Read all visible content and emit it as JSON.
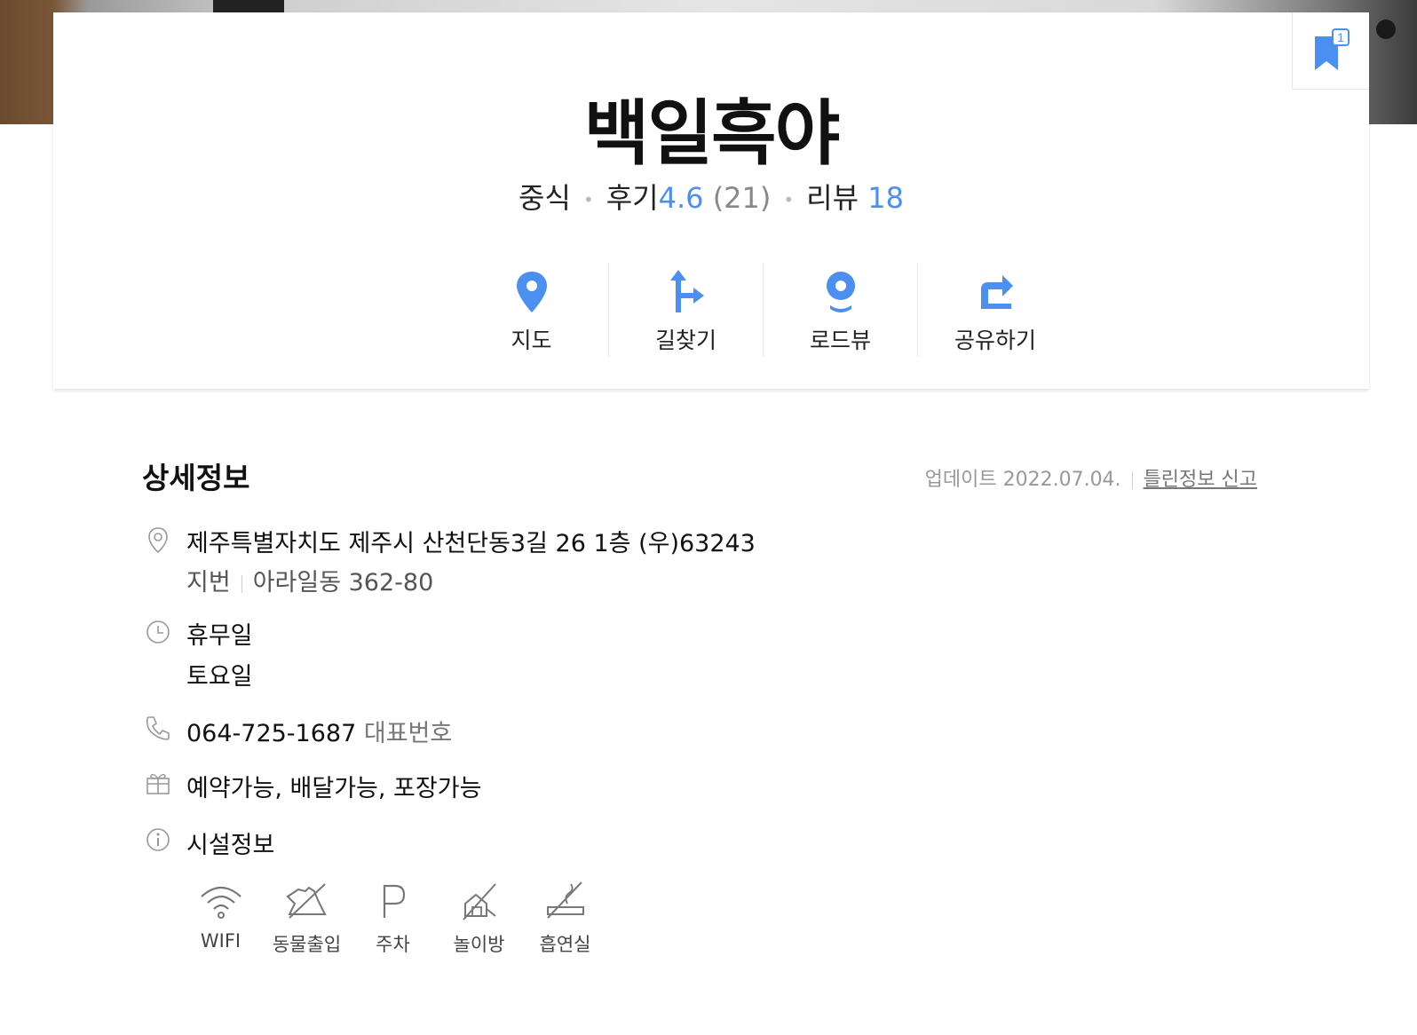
{
  "header": {
    "bookmark_count": "1",
    "place_name": "백일흑야",
    "category": "중식",
    "review_label": "후기",
    "rating": "4.6",
    "rating_count": "(21)",
    "review2_label": "리뷰",
    "review2_count": "18"
  },
  "actions": [
    {
      "label": "지도",
      "icon": "map-pin-icon"
    },
    {
      "label": "길찾기",
      "icon": "directions-icon"
    },
    {
      "label": "로드뷰",
      "icon": "roadview-icon"
    },
    {
      "label": "공유하기",
      "icon": "share-icon"
    }
  ],
  "detail": {
    "title": "상세정보",
    "updated": "업데이트 2022.07.04.",
    "report_label": "틀린정보 신고",
    "address": "제주특별자치도 제주시 산천단동3길 26 1층 (우)63243",
    "lot_label": "지번",
    "lot_address": "아라일동 362-80",
    "holiday_label": "휴무일",
    "holiday_value": "토요일",
    "phone": "064-725-1687",
    "phone_label": "대표번호",
    "services": "예약가능, 배달가능, 포장가능",
    "facility_title": "시설정보",
    "facilities": [
      {
        "label": "WIFI",
        "icon": "wifi-icon"
      },
      {
        "label": "동물출입",
        "icon": "no-pets-icon"
      },
      {
        "label": "주차",
        "icon": "parking-icon"
      },
      {
        "label": "놀이방",
        "icon": "no-playroom-icon"
      },
      {
        "label": "흡연실",
        "icon": "no-smoking-icon"
      }
    ]
  },
  "colors": {
    "accent": "#4b8ff0",
    "text": "#222222"
  }
}
